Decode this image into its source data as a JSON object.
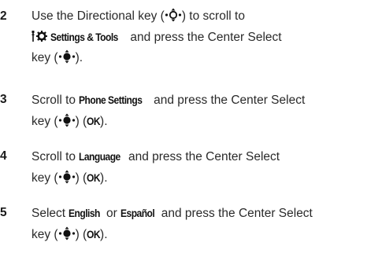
{
  "steps": [
    {
      "number": "2",
      "line1_a": "Use the Directional key (",
      "line1_b": ") to scroll to",
      "menu_label": "Settings & Tools",
      "line2_b": " and press the Center Select",
      "line3_a": "key (",
      "line3_b": ")."
    },
    {
      "number": "3",
      "line1_a": "Scroll to ",
      "item": "Phone Settings",
      "line1_b": " and press the Center Select",
      "line2_a": "key (",
      "line2_b": ") (",
      "ok": "OK",
      "line2_c": ")."
    },
    {
      "number": "4",
      "line1_a": "Scroll to ",
      "item": "Language",
      "line1_b": " and press the Center Select",
      "line2_a": "key (",
      "line2_b": ") (",
      "ok": "OK",
      "line2_c": ")."
    },
    {
      "number": "5",
      "line1_a": "Select ",
      "item_a": "English",
      "line1_b": " or ",
      "item_b": "Español",
      "line1_c": " and press the Center Select",
      "line2_a": "key (",
      "line2_b": ") (",
      "ok": "OK",
      "line2_c": ")."
    }
  ],
  "icons": {
    "directional_key": "directional-key-icon",
    "center_select_key": "center-select-key-icon",
    "settings_tools": "settings-tools-icon"
  }
}
